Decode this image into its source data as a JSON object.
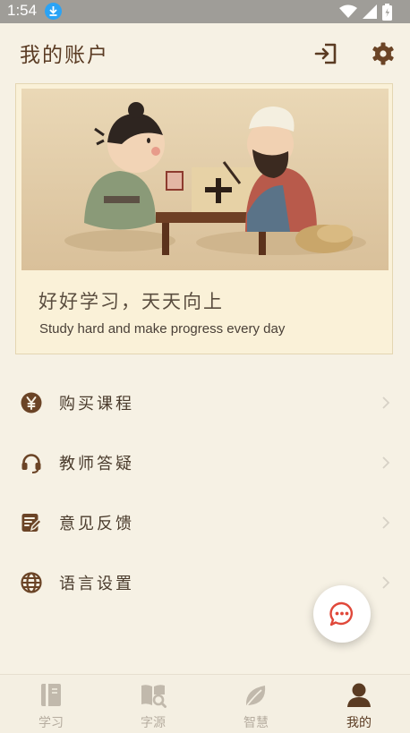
{
  "statusbar": {
    "time": "1:54"
  },
  "header": {
    "title": "我的账户",
    "logout_icon": "logout-icon",
    "settings_icon": "gear-icon"
  },
  "banner": {
    "motto": "好好学习，天天向上",
    "subtitle": "Study hard and make progress every day"
  },
  "menu": {
    "items": [
      {
        "label": "购买课程",
        "icon": "yen-icon"
      },
      {
        "label": "教师答疑",
        "icon": "headset-icon"
      },
      {
        "label": "意见反馈",
        "icon": "feedback-icon"
      },
      {
        "label": "语言设置",
        "icon": "globe-icon"
      }
    ]
  },
  "fab": {
    "icon": "chat-icon"
  },
  "tabbar": {
    "tabs": [
      {
        "label": "学习",
        "icon": "book-icon",
        "active": false
      },
      {
        "label": "字源",
        "icon": "book-search-icon",
        "active": false
      },
      {
        "label": "智慧",
        "icon": "leaf-icon",
        "active": false
      },
      {
        "label": "我的",
        "icon": "person-icon",
        "active": true
      }
    ]
  },
  "colors": {
    "background": "#f6f1e4",
    "accent_brown": "#5a3b22",
    "inactive_tab": "#b6ada0",
    "status_bar": "#9f9d98"
  }
}
